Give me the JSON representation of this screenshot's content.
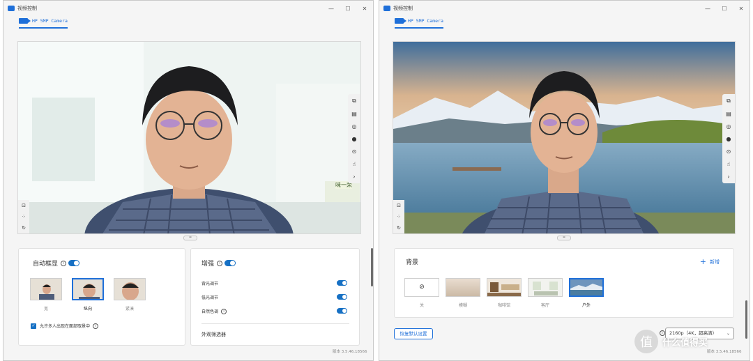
{
  "left_window": {
    "title": "视频控制",
    "window_buttons": [
      "—",
      "☐",
      "✕"
    ],
    "camera_tab": "HP 5MP Camera",
    "auto_framing": {
      "heading": "自动框显",
      "options": [
        {
          "label": "宽"
        },
        {
          "label": "纵向"
        },
        {
          "label": "紧凑"
        }
      ],
      "selected": "纵向",
      "multi_person_checkbox": "允许多人出现在面部取景中"
    },
    "enhance": {
      "heading": "增强",
      "rows": [
        {
          "label": "背光调节"
        },
        {
          "label": "低光调节"
        },
        {
          "label": "自然色调"
        }
      ],
      "filter_label": "外观筛选器"
    },
    "version": "版本 3.5.46.18566"
  },
  "right_window": {
    "title": "视频控制",
    "window_buttons": [
      "—",
      "☐",
      "✕"
    ],
    "camera_tab": "HP 5MP Camera",
    "background": {
      "heading": "背景",
      "add_label": "新增",
      "options": [
        {
          "label": "关"
        },
        {
          "label": "模糊"
        },
        {
          "label": "咖啡馆"
        },
        {
          "label": "客厅"
        },
        {
          "label": "户外"
        }
      ],
      "selected": "户外"
    },
    "reset_button": "恢复默认设置",
    "resolution": "2160p（4K，超高清）",
    "version": "版本 3.5.46.18566"
  },
  "preview_overlay_text": "味一荣",
  "watermark": {
    "logo": "值",
    "text": "什么值得买"
  },
  "colors": {
    "accent": "#1e6fd9",
    "toggle_on": "#1670c4"
  }
}
